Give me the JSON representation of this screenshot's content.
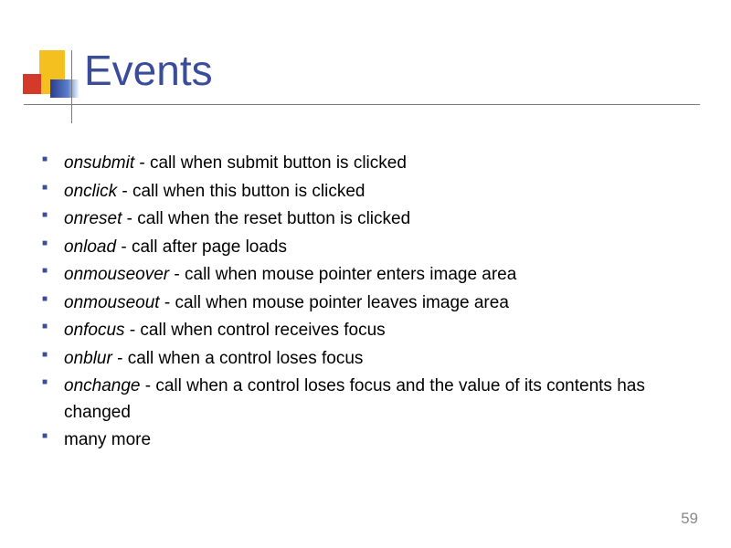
{
  "title": "Events",
  "items": [
    {
      "name": "onsubmit",
      "desc": " - call when submit button is clicked"
    },
    {
      "name": "onclick",
      "desc": " - call when this button is clicked"
    },
    {
      "name": "onreset",
      "desc": " - call when the reset button is clicked"
    },
    {
      "name": "onload",
      "desc": " - call after page loads"
    },
    {
      "name": "onmouseover",
      "desc": " - call when mouse pointer enters image area"
    },
    {
      "name": "onmouseout",
      "desc": " - call when mouse pointer leaves image area"
    },
    {
      "name": "onfocus",
      "desc": " - call when control receives focus"
    },
    {
      "name": "onblur",
      "desc": " - call when a control loses focus"
    },
    {
      "name": "onchange",
      "desc": " - call when a control loses focus and the value of its contents has changed"
    },
    {
      "name": "",
      "desc": "many more"
    }
  ],
  "page_number": "59"
}
